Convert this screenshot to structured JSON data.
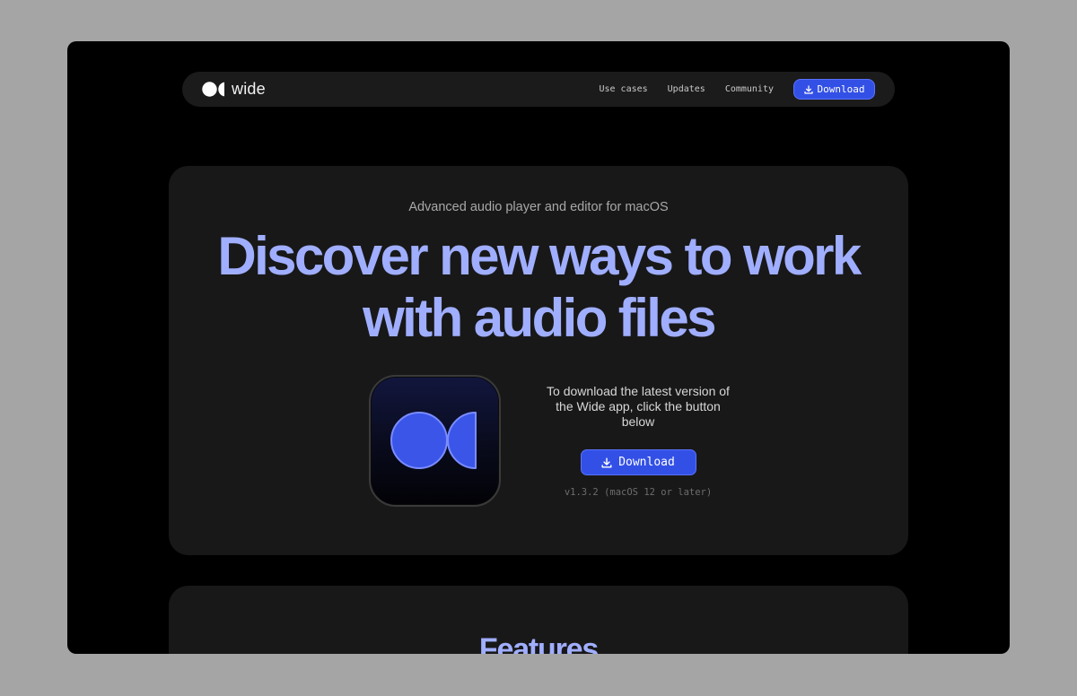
{
  "brand": {
    "name": "wide",
    "logo_icon": "wide-logo-icon"
  },
  "nav": {
    "links": [
      "Use cases",
      "Updates",
      "Community"
    ],
    "download_label": "Download",
    "download_icon": "download-icon"
  },
  "hero": {
    "subtitle": "Advanced audio player and editor for macOS",
    "title_line1": "Discover new ways to work",
    "title_line2": "with audio files",
    "app_icon": "wide-app-icon",
    "download_text": "To download the latest version of the Wide app, click the button below",
    "download_label": "Download",
    "version": "v1.3.2 (macOS 12 or later)"
  },
  "features": {
    "title": "Features"
  },
  "colors": {
    "accent": "#3350e6",
    "heading": "#a0aeff",
    "card": "#181818",
    "background": "#000000"
  }
}
